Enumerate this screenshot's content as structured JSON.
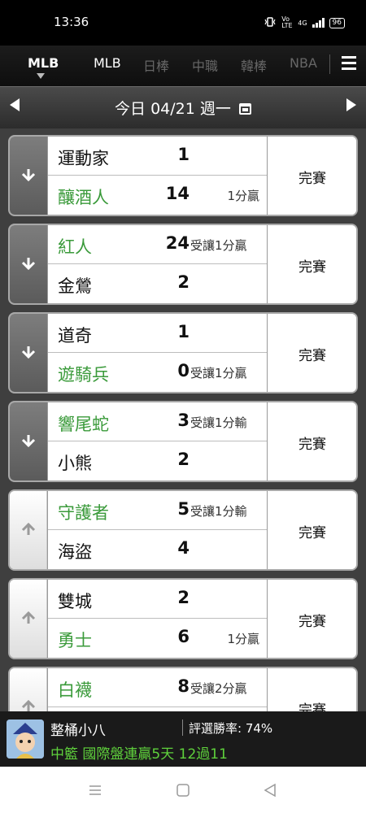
{
  "status_bar": {
    "time": "13:36",
    "network": "Vo LTE",
    "signal": "4G",
    "battery": "96"
  },
  "nav": {
    "current": "MLB",
    "tabs": [
      "MLB",
      "日棒",
      "中職",
      "韓棒",
      "NBA"
    ]
  },
  "date_bar": {
    "date_text": "今日 04/21 週一"
  },
  "games": [
    {
      "state": "final",
      "teams": [
        {
          "name": "運動家",
          "score": "1",
          "note": "",
          "color": "black"
        },
        {
          "name": "釀酒人",
          "score": "14",
          "note": "1分贏",
          "color": "green"
        }
      ],
      "result": "完賽"
    },
    {
      "state": "final",
      "teams": [
        {
          "name": "紅人",
          "score": "24",
          "note": "受讓1分贏",
          "color": "green"
        },
        {
          "name": "金鶯",
          "score": "2",
          "note": "",
          "color": "black"
        }
      ],
      "result": "完賽"
    },
    {
      "state": "final",
      "teams": [
        {
          "name": "道奇",
          "score": "1",
          "note": "",
          "color": "black"
        },
        {
          "name": "遊騎兵",
          "score": "0",
          "note": "受讓1分贏",
          "color": "green"
        }
      ],
      "result": "完賽"
    },
    {
      "state": "final",
      "teams": [
        {
          "name": "響尾蛇",
          "score": "3",
          "note": "受讓1分輸",
          "color": "green"
        },
        {
          "name": "小熊",
          "score": "2",
          "note": "",
          "color": "black"
        }
      ],
      "result": "完賽"
    },
    {
      "state": "live",
      "teams": [
        {
          "name": "守護者",
          "score": "5",
          "note": "受讓1分輸",
          "color": "green"
        },
        {
          "name": "海盜",
          "score": "4",
          "note": "",
          "color": "black"
        }
      ],
      "result": "完賽"
    },
    {
      "state": "live",
      "teams": [
        {
          "name": "雙城",
          "score": "2",
          "note": "",
          "color": "black"
        },
        {
          "name": "勇士",
          "score": "6",
          "note": "1分贏",
          "color": "green"
        }
      ],
      "result": "完賽"
    },
    {
      "state": "live",
      "teams": [
        {
          "name": "白襪",
          "score": "8",
          "note": "受讓2分贏",
          "color": "green"
        },
        {
          "name": "",
          "score": "",
          "note": "",
          "color": "black"
        }
      ],
      "result": "完賽"
    }
  ],
  "banner": {
    "username": "整桶小八",
    "win_rate": "評選勝率: 74%",
    "promo": "中籃 國際盤連贏5天 12過11"
  },
  "colors": {
    "green": "#3a9a3a",
    "promo_green": "#5fd13c"
  },
  "icons": {
    "final": "arrow-down-icon",
    "live": "arrow-up-icon",
    "menu": "hamburger-menu-icon",
    "calendar": "calendar-icon"
  }
}
